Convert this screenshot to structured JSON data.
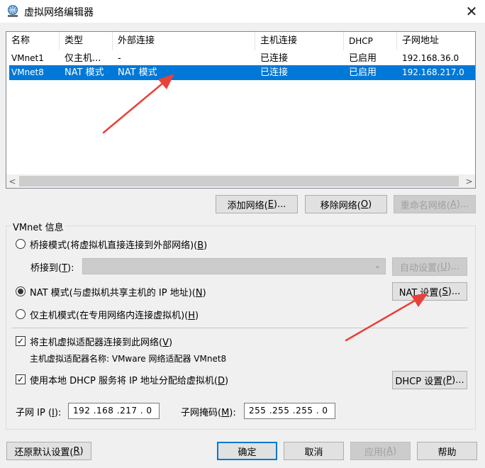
{
  "window": {
    "title": "虚拟网络编辑器",
    "close_glyph": "✕"
  },
  "table": {
    "columns": [
      "名称",
      "类型",
      "外部连接",
      "主机连接",
      "DHCP",
      "子网地址"
    ],
    "rows": [
      {
        "name": "VMnet1",
        "type": "仅主机...",
        "external": "-",
        "host": "已连接",
        "dhcp": "已启用",
        "subnet": "192.168.36.0",
        "selected": false
      },
      {
        "name": "VMnet8",
        "type": "NAT 模式",
        "external": "NAT 模式",
        "host": "已连接",
        "dhcp": "已启用",
        "subnet": "192.168.217.0",
        "selected": true
      }
    ],
    "scroll_left": "<",
    "scroll_right": ">"
  },
  "network_buttons": {
    "add": {
      "text": "添加网络(",
      "key": "E",
      "tail": ")..."
    },
    "remove": {
      "text": "移除网络(",
      "key": "O",
      "tail": ")"
    },
    "rename": {
      "text": "重命名网络(",
      "key": "A",
      "tail": ")..."
    }
  },
  "vmnet_info": {
    "title": "VMnet 信息",
    "bridged": {
      "text": "桥接模式(将虚拟机直接连接到外部网络)(",
      "key": "B",
      "tail": ")"
    },
    "bridge_to": {
      "text": "桥接到(",
      "key": "T",
      "tail": "):",
      "value": ""
    },
    "auto_settings": {
      "text": "自动设置(",
      "key": "U",
      "tail": ")..."
    },
    "nat": {
      "text": "NAT 模式(与虚拟机共享主机的 IP 地址)(",
      "key": "N",
      "tail": ")"
    },
    "nat_settings": {
      "text": "NAT 设置(",
      "key": "S",
      "tail": ")..."
    },
    "host_only": {
      "text": "仅主机模式(在专用网络内连接虚拟机)(",
      "key": "H",
      "tail": ")"
    },
    "selected_mode": "nat",
    "connect_adapter": {
      "text": "将主机虚拟适配器连接到此网络(",
      "key": "V",
      "tail": ")",
      "checked": true
    },
    "adapter_name": "主机虚拟适配器名称: VMware 网络适配器 VMnet8",
    "use_dhcp": {
      "text": "使用本地 DHCP 服务将 IP 地址分配给虚拟机(",
      "key": "D",
      "tail": ")",
      "checked": true
    },
    "dhcp_settings": {
      "text": "DHCP 设置(",
      "key": "P",
      "tail": ")..."
    },
    "subnet_ip": {
      "text": "子网 IP (",
      "key": "I",
      "tail": "):",
      "value": "192 .168 .217 . 0"
    },
    "subnet_mask": {
      "text": "子网掩码(",
      "key": "M",
      "tail": "):",
      "value": "255 .255 .255 . 0"
    }
  },
  "footer": {
    "restore": {
      "text": "还原默认设置(",
      "key": "R",
      "tail": ")"
    },
    "ok": "确定",
    "cancel": "取消",
    "apply": {
      "text": "应用(",
      "key": "A",
      "tail": ")"
    },
    "help": "帮助"
  },
  "colors": {
    "selection": "#0078d7",
    "annotation_arrow": "#e8413a"
  },
  "icons": [
    "network-globe-icon",
    "close-icon",
    "scroll-left-icon",
    "scroll-right-icon",
    "dropdown-arrow-icon",
    "checkmark-icon",
    "annotation-arrow-icon"
  ]
}
